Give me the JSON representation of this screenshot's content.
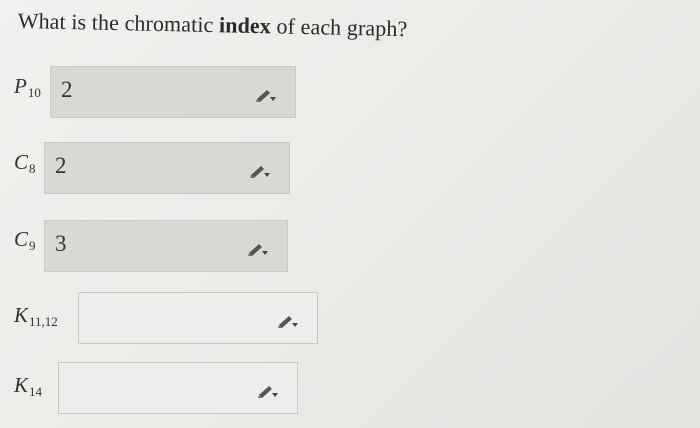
{
  "question": {
    "before": "What is the chromatic",
    "bold": "index",
    "after": "of each graph?"
  },
  "rows": [
    {
      "label": "P",
      "subscript": "10",
      "value": "2"
    },
    {
      "label": "C",
      "subscript": "8",
      "value": "2"
    },
    {
      "label": "C",
      "subscript": "9",
      "value": "3"
    },
    {
      "label": "K",
      "subscript": "11,12",
      "value": ""
    },
    {
      "label": "K",
      "subscript": "14",
      "value": ""
    }
  ],
  "icons": {
    "edit": "pencil-icon"
  }
}
